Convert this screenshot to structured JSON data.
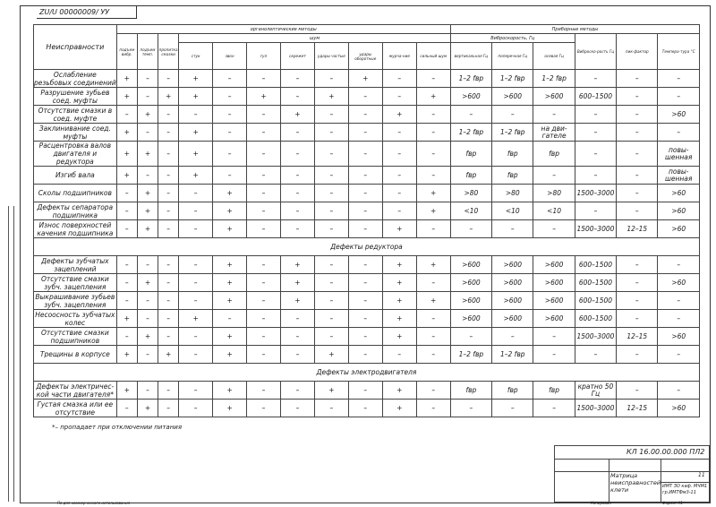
{
  "document": {
    "code": "ZU/U 00000009/ УУ",
    "footnote": "*– пропадает при отключении питания",
    "bottom_note": "По для коммерческого использования",
    "bottom_copy": "Копировал",
    "bottom_format": "Формат А1"
  },
  "header": {
    "faults_label": "Неисправности",
    "group_organoleptic": "органолептические методы",
    "group_noise": "шум",
    "group_instrumental": "Приборные методы",
    "vibro_label": "Виброскорость, Гц",
    "sub_organoleptic": [
      "подъем вибр.",
      "подъем темп.",
      "пропитка смазки"
    ],
    "sub_noise": [
      "стук",
      "звон",
      "гул",
      "скрежет",
      "удары частые",
      "удары оборотные",
      "журча-ние",
      "сильный шум"
    ],
    "sub_vibro": [
      "вертикальная Гц",
      "поперечная Гц",
      "осевая Гц"
    ],
    "sub_other": [
      "Виброско-рость Гц",
      "пик-фактор",
      "Темпера-тура °С"
    ]
  },
  "rows": [
    {
      "fault": "Ослабление резьбовых соединений",
      "marks": [
        "+",
        "–",
        "–",
        "+",
        "–",
        "–",
        "–",
        "–",
        "+",
        "–",
        "–"
      ],
      "vert": "1–2 fвр",
      "pop": "1–2 fвр",
      "os": "1–2 fвр",
      "speed": "–",
      "peak": "–",
      "temp": "–"
    },
    {
      "fault": "Разрушение зубьев соед. муфты",
      "marks": [
        "+",
        "–",
        "+",
        "+",
        "–",
        "+",
        "–",
        "+",
        "–",
        "–",
        "+"
      ],
      "vert": ">600",
      "pop": ">600",
      "os": ">600",
      "speed": "600–1500",
      "peak": "–",
      "temp": "–"
    },
    {
      "fault": "Отсутствие смазки в соед. муфте",
      "marks": [
        "–",
        "+",
        "–",
        "–",
        "–",
        "–",
        "+",
        "–",
        "–",
        "+",
        "–"
      ],
      "vert": "–",
      "pop": "–",
      "os": "–",
      "speed": "–",
      "peak": "–",
      "temp": ">60"
    },
    {
      "fault": "Заклинивание соед. муфты",
      "marks": [
        "+",
        "–",
        "–",
        "+",
        "–",
        "–",
        "–",
        "–",
        "–",
        "–",
        "–"
      ],
      "vert": "1–2 fвр",
      "pop": "1–2 fвр",
      "os": "на дви-гателе",
      "speed": "–",
      "peak": "–",
      "temp": "–"
    },
    {
      "fault": "Расцентровка валов двигателя и редуктора",
      "marks": [
        "+",
        "+",
        "–",
        "+",
        "–",
        "–",
        "–",
        "–",
        "–",
        "–",
        "–"
      ],
      "vert": "fвр",
      "pop": "fвр",
      "os": "fвр",
      "speed": "–",
      "peak": "–",
      "temp": "повы-шенная"
    },
    {
      "fault": "Изгиб вала",
      "marks": [
        "+",
        "–",
        "–",
        "+",
        "–",
        "–",
        "–",
        "–",
        "–",
        "–",
        "–"
      ],
      "vert": "fвр",
      "pop": "fвр",
      "os": "–",
      "speed": "–",
      "peak": "–",
      "temp": "повы-шенная"
    },
    {
      "fault": "Сколы подшипников",
      "marks": [
        "–",
        "+",
        "–",
        "–",
        "+",
        "–",
        "–",
        "–",
        "–",
        "–",
        "+"
      ],
      "vert": ">80",
      "pop": ">80",
      "os": ">80",
      "speed": "1500–3000",
      "peak": "–",
      "temp": ">60"
    },
    {
      "fault": "Дефекты сепаратора подшипника",
      "marks": [
        "–",
        "+",
        "–",
        "–",
        "+",
        "–",
        "–",
        "–",
        "–",
        "–",
        "+"
      ],
      "vert": "<10",
      "pop": "<10",
      "os": "<10",
      "speed": "–",
      "peak": "–",
      "temp": ">60"
    },
    {
      "fault": "Износ поверхностей качения подшипника",
      "marks": [
        "–",
        "+",
        "–",
        "–",
        "+",
        "–",
        "–",
        "–",
        "–",
        "+",
        "–"
      ],
      "vert": "–",
      "pop": "–",
      "os": "–",
      "speed": "1500–3000",
      "peak": "12–15",
      "temp": ">60"
    }
  ],
  "section_reducer": "Дефекты редуктора",
  "rows_reducer": [
    {
      "fault": "Дефекты зубчатых зацеплений",
      "marks": [
        "–",
        "–",
        "–",
        "–",
        "+",
        "–",
        "+",
        "–",
        "–",
        "+",
        "+"
      ],
      "vert": ">600",
      "pop": ">600",
      "os": ">600",
      "speed": "600–1500",
      "peak": "–",
      "temp": "–"
    },
    {
      "fault": "Отсутствие смазки зубч. зацепления",
      "marks": [
        "–",
        "+",
        "–",
        "–",
        "+",
        "–",
        "+",
        "–",
        "–",
        "+",
        "–"
      ],
      "vert": ">600",
      "pop": ">600",
      "os": ">600",
      "speed": "600–1500",
      "peak": "–",
      "temp": ">60"
    },
    {
      "fault": "Выкрашивание зубьев зубч. зацепления",
      "marks": [
        "–",
        "–",
        "–",
        "–",
        "+",
        "–",
        "+",
        "–",
        "–",
        "+",
        "+"
      ],
      "vert": ">600",
      "pop": ">600",
      "os": ">600",
      "speed": "600–1500",
      "peak": "–",
      "temp": "–"
    },
    {
      "fault": "Несоосность зубчатых колес",
      "marks": [
        "+",
        "–",
        "–",
        "+",
        "–",
        "–",
        "–",
        "–",
        "–",
        "+",
        "–"
      ],
      "vert": ">600",
      "pop": ">600",
      "os": ">600",
      "speed": "600–1500",
      "peak": "–",
      "temp": "–"
    },
    {
      "fault": "Отсутствие смазки подшипников",
      "marks": [
        "–",
        "+",
        "–",
        "–",
        "+",
        "–",
        "–",
        "–",
        "–",
        "+",
        "–"
      ],
      "vert": "–",
      "pop": "–",
      "os": "–",
      "speed": "1500–3000",
      "peak": "12–15",
      "temp": ">60"
    },
    {
      "fault": "Трещины в корпусе",
      "marks": [
        "+",
        "–",
        "+",
        "–",
        "+",
        "–",
        "–",
        "+",
        "–",
        "–",
        "–"
      ],
      "vert": "1–2 fвр",
      "pop": "1–2 fвр",
      "os": "–",
      "speed": "–",
      "peak": "–",
      "temp": "–"
    }
  ],
  "section_motor": "Дефекты электродвигателя",
  "rows_motor": [
    {
      "fault": "Дефекты электричес-кой части двигателя*",
      "marks": [
        "+",
        "–",
        "–",
        "–",
        "+",
        "–",
        "–",
        "+",
        "–",
        "+",
        "–"
      ],
      "vert": "fвр",
      "pop": "fвр",
      "os": "fвр",
      "speed": "кратно 50 Гц",
      "peak": "–",
      "temp": "–"
    },
    {
      "fault": "Густая смазка или ее отсутствие",
      "marks": [
        "–",
        "+",
        "–",
        "–",
        "+",
        "–",
        "–",
        "–",
        "–",
        "+",
        "–"
      ],
      "vert": "–",
      "pop": "–",
      "os": "–",
      "speed": "1500–3000",
      "peak": "12–15",
      "temp": ">60"
    }
  ],
  "stamp": {
    "number": "КЛ 16.00.00.000 ПЛ2",
    "title": "Матрица неисправностей клети",
    "sheet_count": "11",
    "org": "ИМТ ЗО каф. МЧМ1 гр.ИМТФм3-11"
  }
}
